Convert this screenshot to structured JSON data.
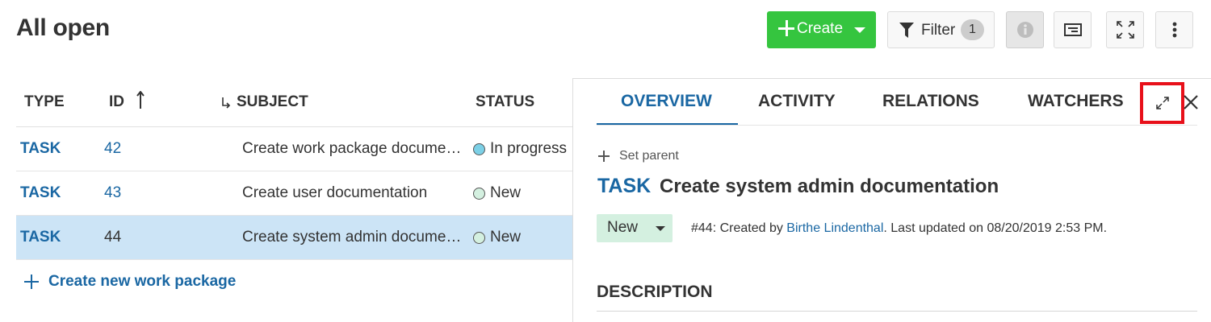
{
  "page": {
    "title": "All open"
  },
  "toolbar": {
    "create_label": "Create",
    "filter_label": "Filter",
    "filter_count": "1"
  },
  "table": {
    "columns": [
      "TYPE",
      "ID",
      "SUBJECT",
      "STATUS"
    ],
    "rows": [
      {
        "type": "TASK",
        "id": "42",
        "subject": "Create work package docume…",
        "status": "In progress"
      },
      {
        "type": "TASK",
        "id": "43",
        "subject": "Create user documentation",
        "status": "New"
      },
      {
        "type": "TASK",
        "id": "44",
        "subject": "Create system admin docume…",
        "status": "New"
      }
    ],
    "create_new_label": "Create new work package"
  },
  "details": {
    "tabs": [
      "OVERVIEW",
      "ACTIVITY",
      "RELATIONS",
      "WATCHERS"
    ],
    "set_parent_label": "Set parent",
    "type": "TASK",
    "subject": "Create system admin documentation",
    "status": "New",
    "meta_prefix": "#44: Created by ",
    "author": "Birthe Lindenthal",
    "meta_suffix": ". Last updated on 08/20/2019 2:53 PM.",
    "description_heading": "DESCRIPTION"
  },
  "colors": {
    "primary": "#1a67a3",
    "create_button": "#35c53f",
    "selected_row": "#cce4f6",
    "status_new": "#d4f0e0",
    "status_in_progress": "#7cd0e6",
    "highlight_box": "#e8101a"
  }
}
